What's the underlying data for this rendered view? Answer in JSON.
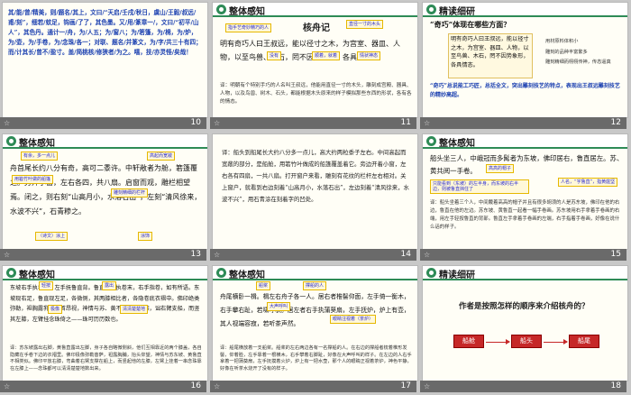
{
  "slides": [
    {
      "number": "10",
      "header": "",
      "body": "其/能/曾/精美，则/题名/其上，文曰/“天启/壬戌/秋日，虞山/王毅/叔远/甫/刻”，细若/蚊足，钩画/了了，其色墨。又/用/篆章一/，文曰/“初平/山人”，其色丹。通计一/舟，为/人五；为/窗八；为/箬篷，为/楫，为/炉，为/壶，为/手卷，为/念珠/各一；对联、题名/并篆文，为/字/共三十有四；而/计其长/曾不/盈寸。盖/简桃核/修狭者/为之。嘻，技/亦灵怪/矣哉！"
    },
    {
      "number": "11",
      "header": "整体感知",
      "title": "核舟记",
      "l1": "明有奇巧人曰王叔远，能以径寸之木，为宫室、器皿、人物，以至鸟兽、木石，罔不因势象形，各具情态。",
      "notes": [
        "指手艺奇妙精巧的人",
        "直径一寸的木头",
        "一寸",
        "器物",
        "没有",
        "顺着，就着",
        "形状",
        "模仿",
        "情状神态"
      ],
      "trans": "译：明朝有个特别手巧的人名叫王叔远，他能用直径一寸的木头，雕刻成宫殿、器具、人物，以及鸟兽、树木、石头，都能根据木头原来的样子模拟那些东西的形状，各有各的情态。"
    },
    {
      "number": "12",
      "header": "精读细研",
      "q": "“奇巧”体现在哪些方面？",
      "quote": "明有奇巧人曰王叔远，能以径寸之木，为宫室、器皿、人物，以至鸟兽、木石，罔不因势象形，各具情态。",
      "side": [
        "用材原料体积小",
        "雕刻的品种丰富繁多",
        "雕刻精细而栩栩传神，传态逼真"
      ],
      "summary": "“奇巧”总说能工巧匠，总括全文，突出雕刻技艺的特点，表现出王叔远雕刻技艺的精妙高超。"
    },
    {
      "number": "13",
      "header": "整体感知",
      "body": "舟首尾长约八分有奇，高可二黍许。中轩敞者为舱，箬篷覆之。旁开小窗，左右各四，共八扇。启窗而观，雕栏相望焉。闭之，则右刻“山高月小，水落石出”，左刻“清风徐来，水波不兴”，石青糁之。",
      "notes": [
        "有余，多一点儿",
        "黍，黍子",
        "高起而宽敞",
        "用箬竹叶做的船篷",
        "盖",
        "雕刻精细的栏杆",
        "打开",
        "（诗文）涂上",
        "“苏东坡赤壁赋”里的句子",
        "（用来）做名",
        "涂饰"
      ]
    },
    {
      "number": "14",
      "header": "",
      "trans": "译：船头到船尾长大约八分多一点儿，高大约两粒黍子左右。中间高起而宽敞的部分，是船舱，用箬竹叶做成的船篷覆盖着它。旁边开着小窗，左右各有四扇，一共八扇。打开窗户来看，雕刻有花纹的栏杆左右相对。关上窗户，就看到右边刻着“山高月小，水落石出”，左边刻着“清风徐来，水波不兴”，用石青涂在刻着字的凹处。"
    },
    {
      "number": "15",
      "header": "整体感知",
      "body": "船头坐三人，中峨冠而多髯者为东坡，佛印居右，鲁直居左。苏、黄共阅一手卷。",
      "notes": [
        "高高的帽子",
        "名词，胡须",
        "只能看到（东坡）的左半身，而东坡的右半边，则被鲁直挡住了",
        "人名，“字鲁直”，指黄庭坚"
      ],
      "trans": "译：船头坐着三个人，中间戴着高高的帽子并且有很多胡须的人是苏东坡，佛印在他的右边，鲁直在他的左边。苏东坡、黄鲁直一起看一幅手卷画。苏东坡用右手拿着手卷画的右端，用左手轻按鲁直的背部。鲁直左手拿着手卷画的左端，右手指着手卷画，好像在说什么话的样子。"
    },
    {
      "number": "16",
      "header": "整体感知",
      "body": "东坡右手执卷端，左手抚鲁直背。鲁直左手执卷末，右手指卷，如有所语。东坡现右足，鲁直现左足，各微侧，其两膝相比者，各隐卷底衣褶中。佛印绝类弥勒，袒胸露乳，矫首昂视，神情与苏、黄不属。卧右膝，诎右臂支船，而竖其左膝，左臂挂念珠倚之——珠可历历数也。",
      "notes": [
        "轻按",
        "露出",
        "靠近",
        "极像",
        "抬头",
        "不相类似",
        "弯曲",
        "清清楚楚地"
      ],
      "trans": "译：苏东坡露出右脚，黄鲁直露出左脚，身子各自略微侧斜，他们互相靠近的两个膝盖，各自隐藏在手卷下边的衣褶里。佛印极像弥勒菩萨，袒露胸脯，抬头仰望，神情与苏东坡、黄鲁直不相类似。佛印平放右膝，弯曲着右臂支撑在船上，而竖起他的左膝，左臂上挂着一串念珠靠在左膝上——念珠都可以清清楚楚地数出来。"
    },
    {
      "number": "17",
      "header": "整体感知",
      "body": "舟尾横卧一楫。楫左右舟子各一人。居右者椎髻仰面，左手倚一衡木，右手攀右趾，若啸呼状。居左者右手执蒲葵扇，左手抚炉，炉上有壶，其人视端容寂，若听茶声然。",
      "notes": [
        "船桨",
        "撑船的人",
        "梳着椎形发髻",
        "横木",
        "大声呼叫",
        "眼睛注视着（茶炉）",
        "神色平静"
      ],
      "trans": "译：船尾横放着一支船桨。船桨的左右两边各有一名撑船的人。在右边的撑船者梳着椎形发髻，仰着脸，左手靠着一根横木，右手攀着右脚趾，好像在大声呼叫的样子。在左边的人右手拿着一把蒲葵扇，左手抚摸着火炉，炉上有一把水壶，那个人的眼睛正视着茶炉，神色平静，好像在听茶水烧开了没有的样子。"
    },
    {
      "number": "18",
      "header": "精读细研",
      "q": "作者是按照怎样的顺序来介绍核舟的？",
      "flow": [
        "船舱",
        "船头",
        "船尾"
      ]
    }
  ]
}
